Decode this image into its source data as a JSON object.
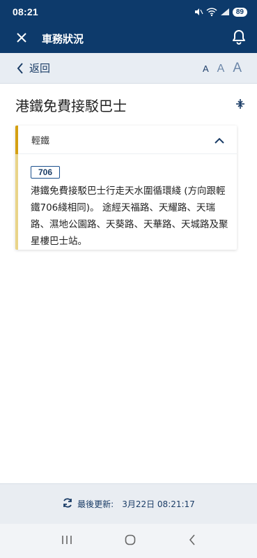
{
  "status_bar": {
    "time": "08:21",
    "battery": "89"
  },
  "app_bar": {
    "title": "車務狀況",
    "close_icon": "close-icon",
    "bell_icon": "bell-icon"
  },
  "sub_bar": {
    "back_label": "返回",
    "font_small": "A",
    "font_medium": "A",
    "font_large": "A"
  },
  "page": {
    "title": "港鐵免費接駁巴士"
  },
  "card": {
    "header": "輕鐵",
    "accent_color": "#d4a012",
    "route_number": "706",
    "text": "港鐵免費接駁巴士行走天水圍循環綫 (方向跟輕鐵706綫相同)。 途經天福路、天耀路、天瑞路、濕地公園路、天葵路、天華路、天城路及聚星樓巴士站。"
  },
  "footer": {
    "label": "最後更新:",
    "time": "3月22日 08:21:17"
  },
  "colors": {
    "primary": "#0d3a6b",
    "sub_bar_bg": "#e8edf3"
  }
}
